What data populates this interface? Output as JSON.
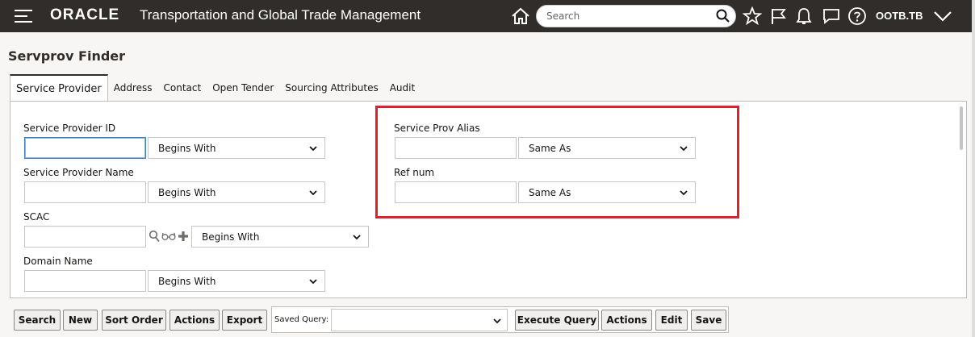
{
  "header": {
    "brand": "ORACLE",
    "product": "Transportation and Global Trade Management",
    "search_placeholder": "Search",
    "user": "OOTB.TB"
  },
  "page": {
    "title": "Servprov Finder"
  },
  "tabs": [
    {
      "label": "Service Provider",
      "active": true
    },
    {
      "label": "Address"
    },
    {
      "label": "Contact"
    },
    {
      "label": "Open Tender"
    },
    {
      "label": "Sourcing Attributes"
    },
    {
      "label": "Audit"
    }
  ],
  "fields": {
    "service_provider_id": {
      "label": "Service Provider ID",
      "value": "",
      "operator": "Begins With"
    },
    "service_provider_name": {
      "label": "Service Provider Name",
      "value": "",
      "operator": "Begins With"
    },
    "scac": {
      "label": "SCAC",
      "value": "",
      "operator": "Begins With"
    },
    "domain_name": {
      "label": "Domain Name",
      "value": "",
      "operator": "Begins With"
    },
    "service_prov_alias": {
      "label": "Service Prov Alias",
      "value": "",
      "operator": "Same As"
    },
    "ref_num": {
      "label": "Ref num",
      "value": "",
      "operator": "Same As"
    }
  },
  "buttons": {
    "search": "Search",
    "new": "New",
    "sort_order": "Sort Order",
    "actions": "Actions",
    "export": "Export",
    "saved_query_label": "Saved Query:",
    "saved_query_value": "",
    "execute_query": "Execute Query",
    "actions2": "Actions",
    "edit": "Edit",
    "save": "Save"
  },
  "colors": {
    "header_bg": "#312d2a",
    "highlight": "#e0202f"
  }
}
